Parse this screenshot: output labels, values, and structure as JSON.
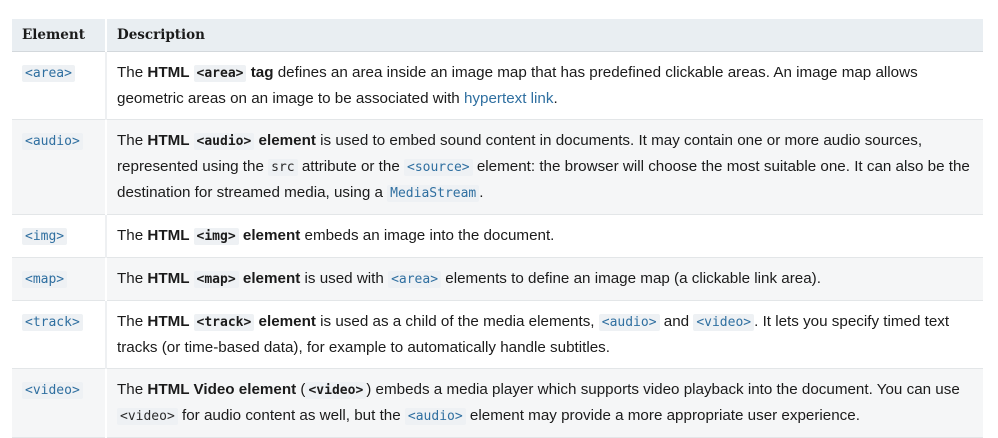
{
  "headers": {
    "element": "Element",
    "description": "Description"
  },
  "rows": [
    {
      "tag": "<area>",
      "p1": "The ",
      "b1": "HTML ",
      "bc": "<area>",
      "b2": " tag",
      "p2": " defines an area inside an image map that has predefined clickable areas. An image map allows geometric areas on an image to be associated with ",
      "link": "hypertext link",
      "p3": "."
    },
    {
      "tag": "<audio>",
      "p1": "The ",
      "b1": "HTML ",
      "bc": "<audio>",
      "b2": " element",
      "p2": " is used to embed sound content in documents. It may contain one or more audio sources, represented using the ",
      "c1": "src",
      "p3": " attribute or the ",
      "c2": "<source>",
      "p4": " element: the browser will choose the most suitable one. It can also be the destination for streamed media, using a ",
      "c3": "MediaStream",
      "p5": "."
    },
    {
      "tag": "<img>",
      "p1": "The ",
      "b1": "HTML ",
      "bc": "<img>",
      "b2": " element",
      "p2": " embeds an image into the document."
    },
    {
      "tag": "<map>",
      "p1": "The ",
      "b1": "HTML ",
      "bc": "<map>",
      "b2": " element",
      "p2": " is used with ",
      "c1": "<area>",
      "p3": " elements to define an image map (a clickable link area)."
    },
    {
      "tag": "<track>",
      "p1": "The ",
      "b1": "HTML ",
      "bc": "<track>",
      "b2": " element",
      "p2": " is used as a child of the media elements, ",
      "c1": "<audio>",
      "p3": " and ",
      "c2": "<video>",
      "p4": ". It lets you specify timed text tracks (or time-based data), for example to automatically handle subtitles."
    },
    {
      "tag": "<video>",
      "p1": "The ",
      "b1": "HTML Video element",
      "p1b": " (",
      "bc": "<video>",
      "p2": ") embeds a media player which supports video playback into the document. You can use ",
      "c1": "<video>",
      "p3": " for audio content as well, but the ",
      "c2": "<audio>",
      "p4": " element may provide a more appropriate user experience."
    }
  ]
}
